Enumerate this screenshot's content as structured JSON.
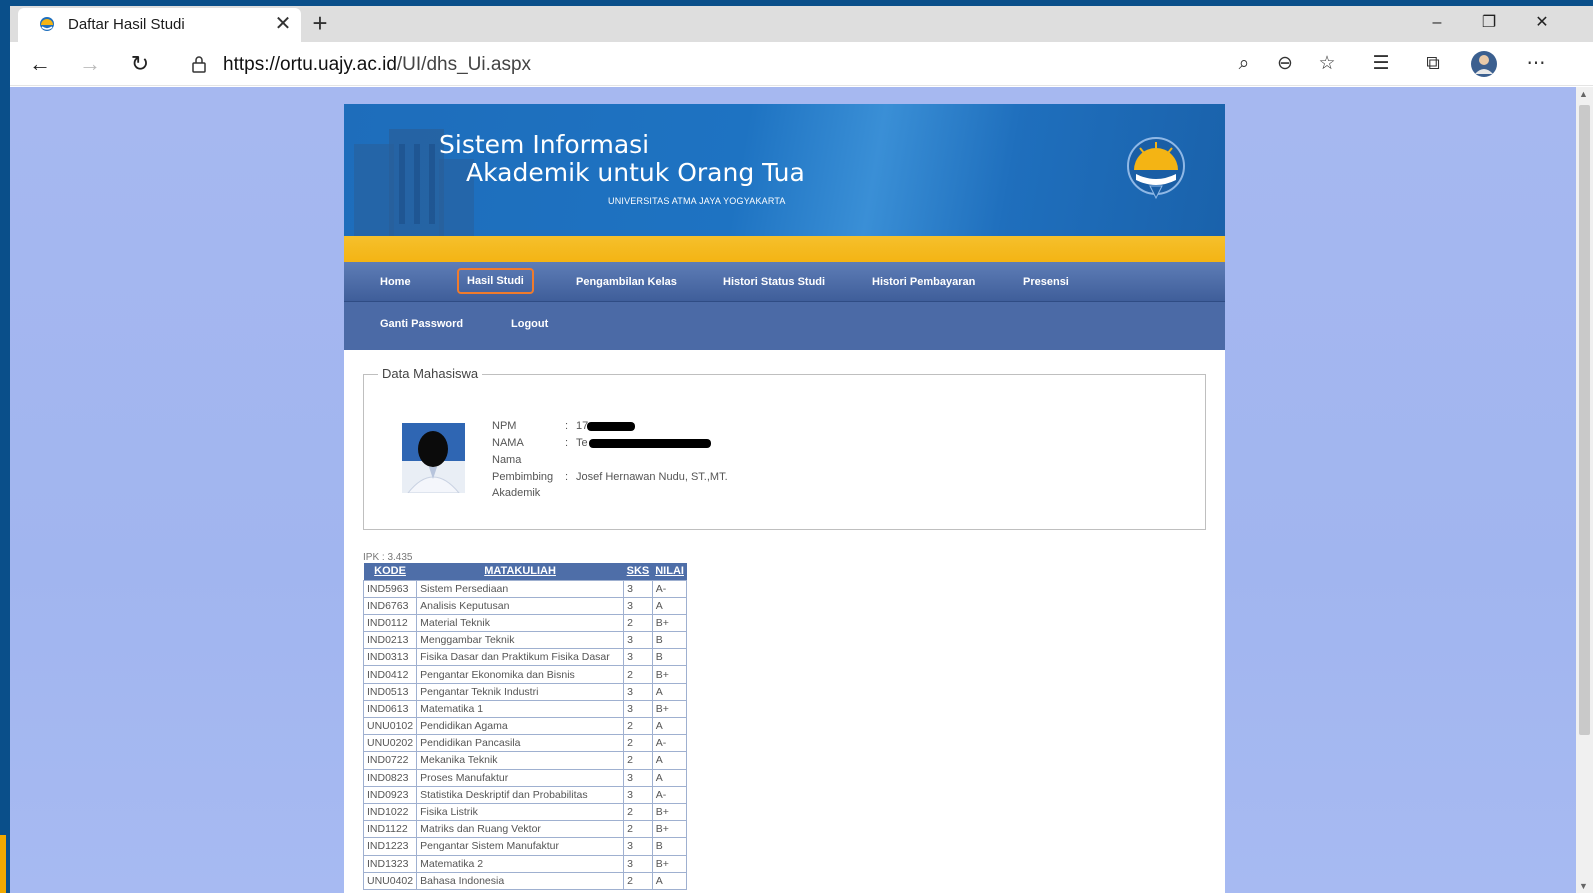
{
  "browser": {
    "tab_title": "Daftar Hasil Studi",
    "tab_close": "✕",
    "new_tab": "+",
    "url_host": "https://ortu.uajy.ac.id",
    "url_path": "/UI/dhs_Ui.aspx",
    "icons": [
      "back-icon",
      "forward-icon",
      "refresh-icon",
      "lock-icon",
      "search-icon",
      "zoom-out-icon",
      "star-icon",
      "favorites-icon",
      "collections-icon",
      "profile-icon",
      "more-icon"
    ]
  },
  "header": {
    "title_line1": "Sistem Informasi",
    "title_line2": "Akademik untuk Orang Tua",
    "subtitle": "UNIVERSITAS ATMA JAYA YOGYAKARTA"
  },
  "menu": {
    "home": "Home",
    "hasil_studi": "Hasil Studi",
    "pengambilan_kelas": "Pengambilan Kelas",
    "histori_status": "Histori Status Studi",
    "histori_pembayaran": "Histori Pembayaran",
    "presensi": "Presensi",
    "ganti_password": "Ganti Password",
    "logout": "Logout"
  },
  "mahasiswa": {
    "legend": "Data Mahasiswa",
    "npm_label": "NPM",
    "npm_value": "17",
    "nama_label": "NAMA",
    "nama_value": "Te",
    "nama_label2": "Nama",
    "pembimbing_label": "Pembimbing",
    "pembimbing_label2": "Akademik",
    "pembimbing_value": "Josef Hernawan Nudu, ST.,MT.",
    "colon": ":"
  },
  "grades": {
    "ipk": "IPK : 3.435",
    "headers": {
      "kode": "KODE",
      "matakuliah": "MATAKULIAH",
      "sks": "SKS",
      "nilai": "NILAI"
    },
    "rows": [
      {
        "kode": "IND5963",
        "mk": "Sistem Persediaan",
        "sks": "3",
        "nilai": "A-"
      },
      {
        "kode": "IND6763",
        "mk": "Analisis Keputusan",
        "sks": "3",
        "nilai": "A"
      },
      {
        "kode": "IND0112",
        "mk": "Material Teknik",
        "sks": "2",
        "nilai": "B+"
      },
      {
        "kode": "IND0213",
        "mk": "Menggambar Teknik",
        "sks": "3",
        "nilai": "B"
      },
      {
        "kode": "IND0313",
        "mk": "Fisika Dasar dan Praktikum Fisika Dasar",
        "sks": "3",
        "nilai": "B"
      },
      {
        "kode": "IND0412",
        "mk": "Pengantar Ekonomika dan Bisnis",
        "sks": "2",
        "nilai": "B+"
      },
      {
        "kode": "IND0513",
        "mk": "Pengantar Teknik Industri",
        "sks": "3",
        "nilai": "A"
      },
      {
        "kode": "IND0613",
        "mk": "Matematika 1",
        "sks": "3",
        "nilai": "B+"
      },
      {
        "kode": "UNU0102",
        "mk": "Pendidikan Agama",
        "sks": "2",
        "nilai": "A"
      },
      {
        "kode": "UNU0202",
        "mk": "Pendidikan Pancasila",
        "sks": "2",
        "nilai": "A-"
      },
      {
        "kode": "IND0722",
        "mk": "Mekanika Teknik",
        "sks": "2",
        "nilai": "A"
      },
      {
        "kode": "IND0823",
        "mk": "Proses Manufaktur",
        "sks": "3",
        "nilai": "A"
      },
      {
        "kode": "IND0923",
        "mk": "Statistika Deskriptif dan Probabilitas",
        "sks": "3",
        "nilai": "A-"
      },
      {
        "kode": "IND1022",
        "mk": "Fisika Listrik",
        "sks": "2",
        "nilai": "B+"
      },
      {
        "kode": "IND1122",
        "mk": "Matriks dan Ruang Vektor",
        "sks": "2",
        "nilai": "B+"
      },
      {
        "kode": "IND1223",
        "mk": "Pengantar Sistem Manufaktur",
        "sks": "3",
        "nilai": "B"
      },
      {
        "kode": "IND1323",
        "mk": "Matematika 2",
        "sks": "3",
        "nilai": "B+"
      },
      {
        "kode": "UNU0402",
        "mk": "Bahasa Indonesia",
        "sks": "2",
        "nilai": "A"
      }
    ]
  },
  "colors": {
    "banner_blue": "#1e6dbb",
    "yellow_bar": "#f4b414",
    "menu_blue": "#4b6aa6",
    "active_outline": "#f07b2c",
    "page_background": "#a6b8f0"
  }
}
